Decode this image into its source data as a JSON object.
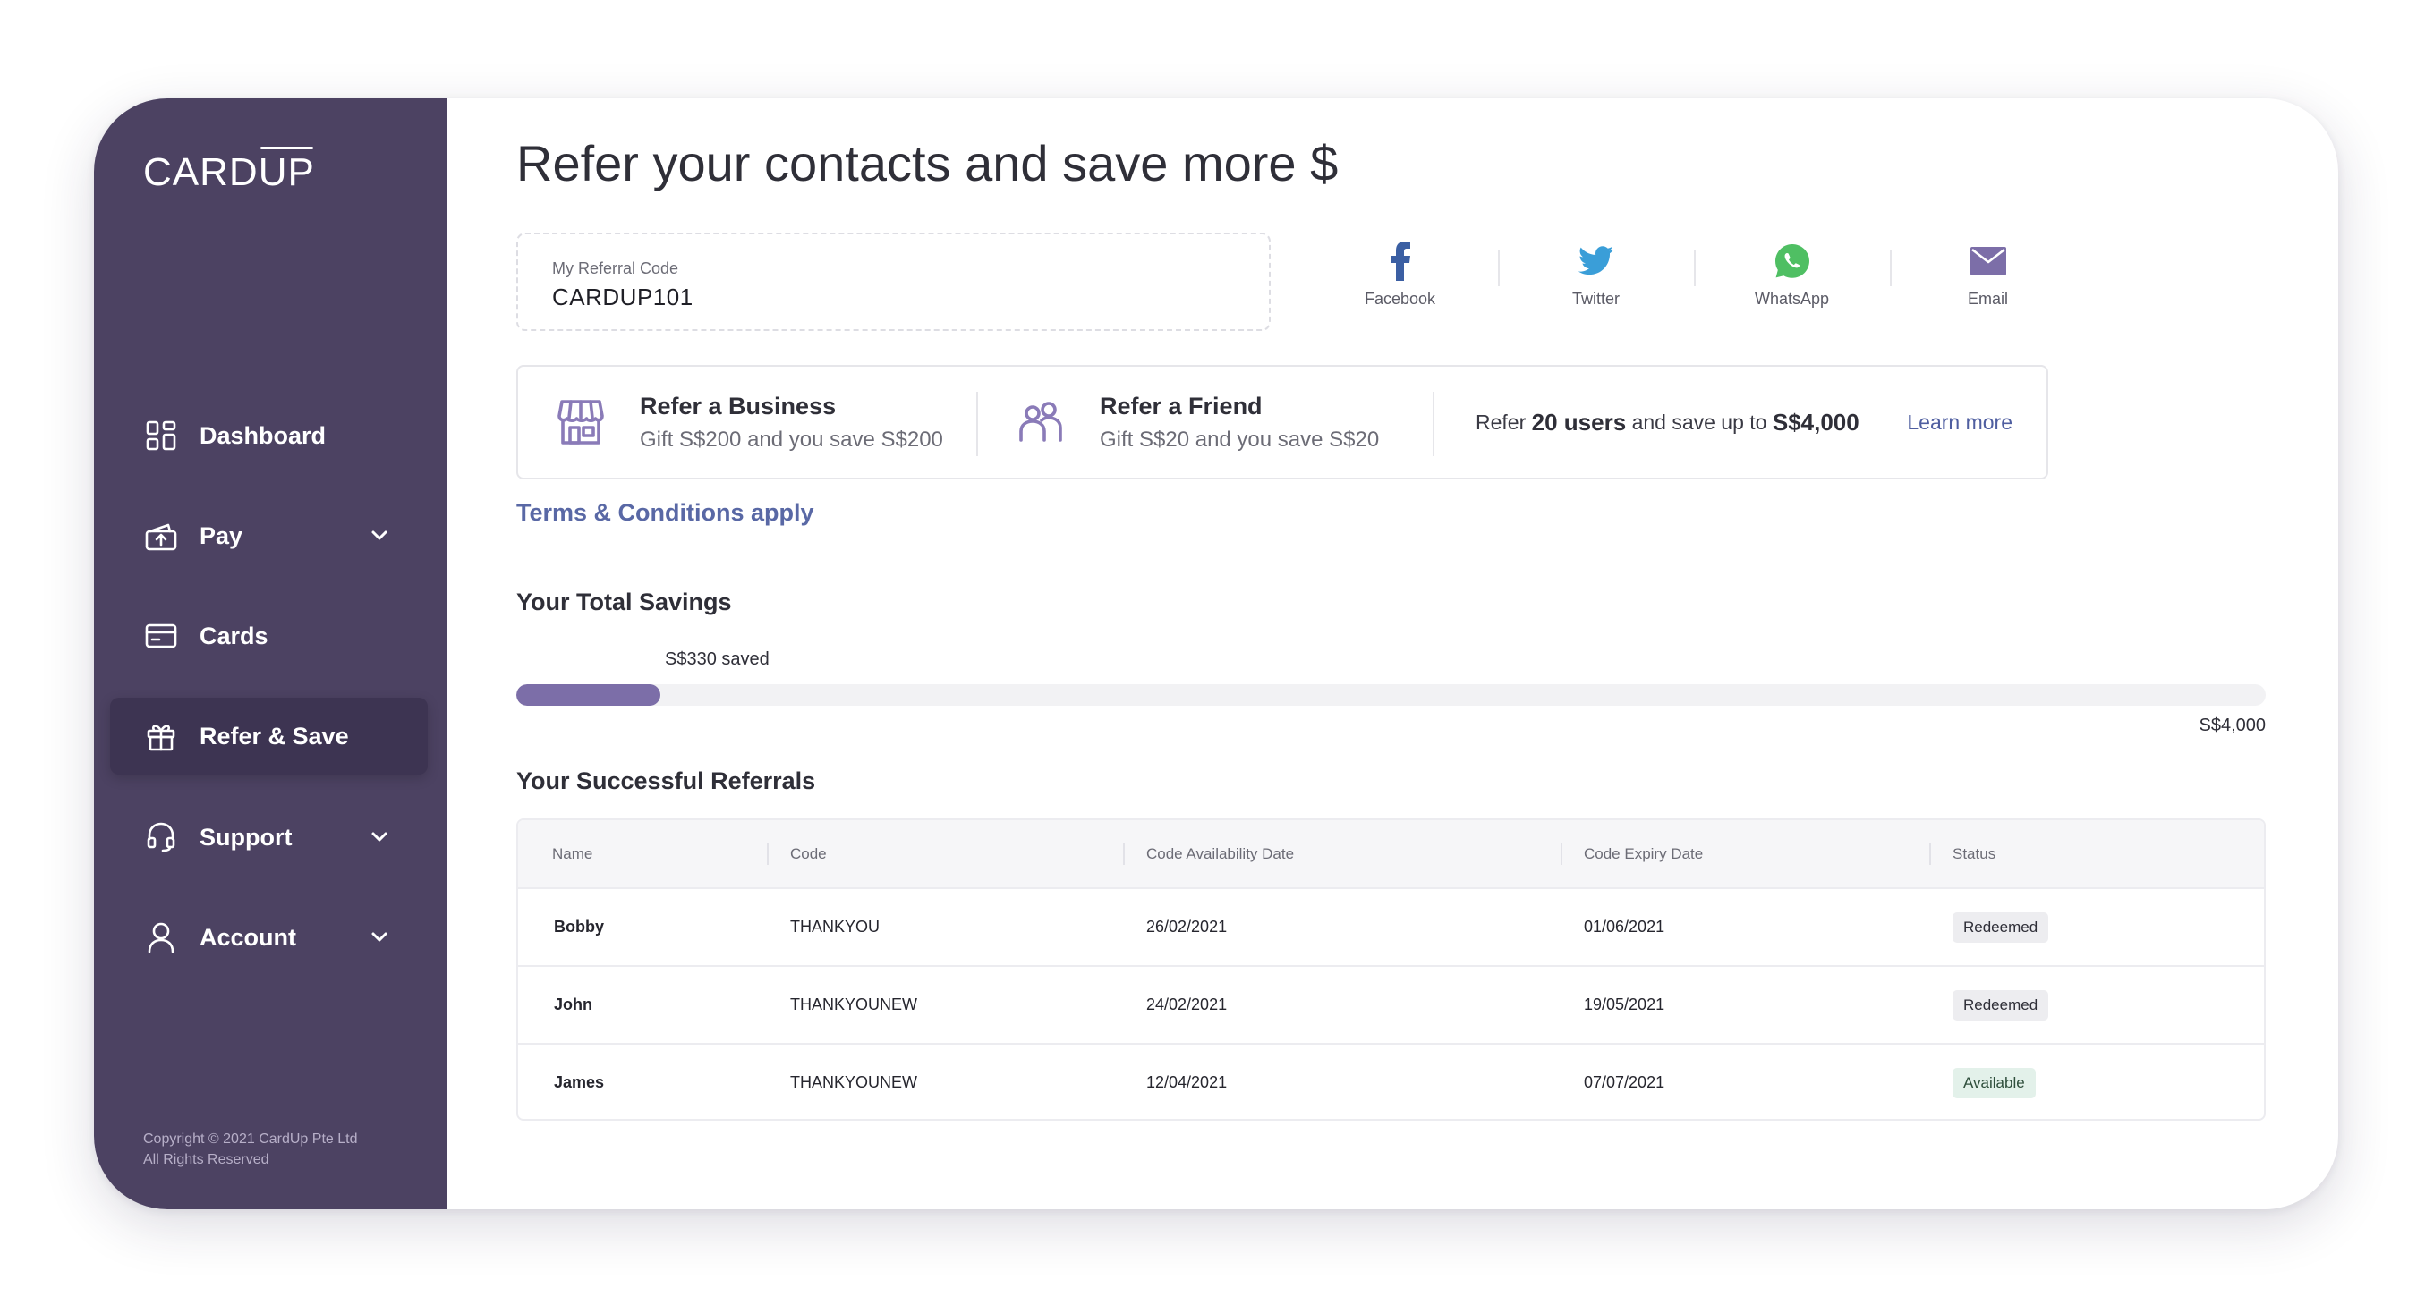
{
  "brand": {
    "logo_prefix": "CARD",
    "logo_suffix": "UP",
    "accent": "#4c4262",
    "link_color": "#5968a5"
  },
  "sidebar": {
    "items": [
      {
        "label": "Dashboard",
        "icon": "dashboard-grid-icon"
      },
      {
        "label": "Pay",
        "icon": "pay-upload-icon",
        "expandable": true
      },
      {
        "label": "Cards",
        "icon": "card-icon"
      },
      {
        "label": "Refer & Save",
        "icon": "gift-icon",
        "active": true
      },
      {
        "label": "Support",
        "icon": "headset-icon",
        "expandable": true
      },
      {
        "label": "Account",
        "icon": "user-icon",
        "expandable": true
      }
    ],
    "copyright": "Copyright © 2021 CardUp Pte Ltd All Rights Reserved"
  },
  "page": {
    "title": "Refer your contacts and save more $"
  },
  "referral": {
    "label": "My Referral Code",
    "code": "CARDUP101"
  },
  "share": [
    {
      "label": "Facebook",
      "icon": "facebook-icon",
      "color": "#3b5fa3"
    },
    {
      "label": "Twitter",
      "icon": "twitter-icon",
      "color": "#3a9ed8"
    },
    {
      "label": "WhatsApp",
      "icon": "whatsapp-icon",
      "color": "#4fbf63"
    },
    {
      "label": "Email",
      "icon": "email-icon",
      "color": "#7c6ea8"
    }
  ],
  "offers": {
    "business": {
      "title": "Refer a Business",
      "subtitle": "Gift S$200 and you save S$200"
    },
    "friend": {
      "title": "Refer a Friend",
      "subtitle": "Gift S$20 and you save S$20"
    },
    "summary": {
      "prefix": "Refer",
      "users": "20 users",
      "middle": "and save up to",
      "amount": "S$4,000"
    },
    "learn_more": "Learn more"
  },
  "terms": "Terms & Conditions apply",
  "savings": {
    "title": "Your Total Savings",
    "saved_label": "S$330 saved",
    "max_label": "S$4,000",
    "progress_fraction": 0.0825
  },
  "referrals": {
    "title": "Your Successful Referrals",
    "columns": [
      "Name",
      "Code",
      "Code Availability Date",
      "Code Expiry Date",
      "Status"
    ],
    "rows": [
      {
        "name": "Bobby",
        "code": "THANKYOU",
        "availability": "26/02/2021",
        "expiry": "01/06/2021",
        "status": "Redeemed"
      },
      {
        "name": "John",
        "code": "THANKYOUNEW",
        "availability": "24/02/2021",
        "expiry": "19/05/2021",
        "status": "Redeemed"
      },
      {
        "name": "James",
        "code": "THANKYOUNEW",
        "availability": "12/04/2021",
        "expiry": "07/07/2021",
        "status": "Available"
      }
    ]
  }
}
